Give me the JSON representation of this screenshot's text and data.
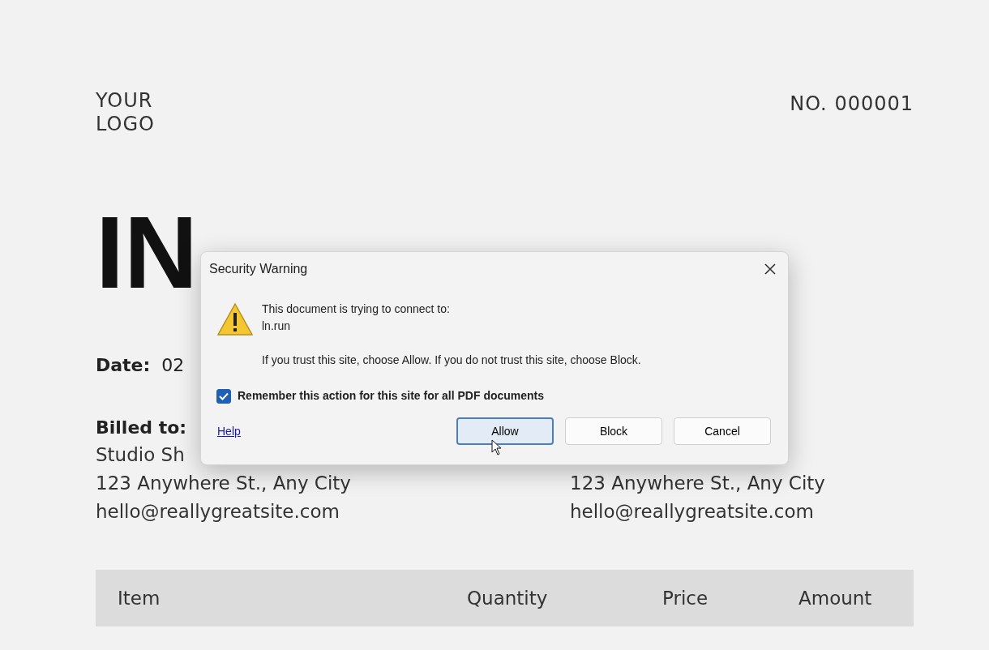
{
  "invoice": {
    "logo": [
      "YOUR",
      "LOGO"
    ],
    "number": "NO. 000001",
    "title": "IN",
    "date_label": "Date:",
    "date_value": "02",
    "billed_label": "Billed to:",
    "billed_lines": [
      "Studio Sh",
      "123 Anywhere St., Any City",
      "hello@reallygreatsite.com"
    ],
    "from_lines": [
      "123 Anywhere St., Any City",
      "hello@reallygreatsite.com"
    ],
    "table": {
      "columns": [
        "Item",
        "Quantity",
        "Price",
        "Amount"
      ]
    }
  },
  "dialog": {
    "title": "Security Warning",
    "message": "This document is trying to connect to:",
    "site": "ln.run",
    "instruction": "If you trust this site, choose Allow. If you do not trust this site, choose Block.",
    "remember": {
      "label": "Remember this action for this site for all PDF documents",
      "checked": true
    },
    "help": "Help",
    "buttons": [
      {
        "label": "Allow",
        "focused": true
      },
      {
        "label": "Block",
        "focused": false
      },
      {
        "label": "Cancel",
        "focused": false
      }
    ]
  }
}
